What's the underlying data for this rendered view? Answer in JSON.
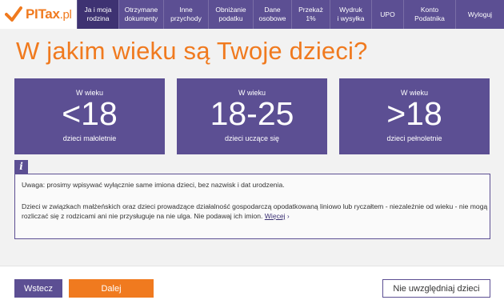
{
  "logo": {
    "text_main": "PITax",
    "text_suffix": ".pl"
  },
  "nav": {
    "items": [
      {
        "label": "Ja i moja\nrodzina",
        "active": true,
        "width": 52
      },
      {
        "label": "Otrzymane\ndokumenty",
        "active": false,
        "width": 56
      },
      {
        "label": "Inne\nprzychody",
        "active": false,
        "width": 56
      },
      {
        "label": "Obniżanie\npodatku",
        "active": false,
        "width": 56
      },
      {
        "label": "Dane\nosobowe",
        "active": false,
        "width": 48
      },
      {
        "label": "Przekaż\n1%",
        "active": false,
        "width": 48
      },
      {
        "label": "Wydruk\ni wysyłka",
        "active": false,
        "width": 52
      },
      {
        "label": "UPO",
        "active": false,
        "width": 40
      },
      {
        "label": "Konto\nPodatnika",
        "active": false,
        "width": 65
      },
      {
        "label": "Wyloguj",
        "active": false,
        "width": 61
      }
    ]
  },
  "page": {
    "title": "W jakim wieku są Twoje dzieci?"
  },
  "cards": [
    {
      "small": "W wieku",
      "big": "<18",
      "desc": "dzieci małoletnie"
    },
    {
      "small": "W wieku",
      "big": "18-25",
      "desc": "dzieci uczące się"
    },
    {
      "small": "W wieku",
      "big": ">18",
      "desc": "dzieci pełnoletnie"
    }
  ],
  "info": {
    "icon": "i",
    "line1": "Uwaga: prosimy wpisywać wyłącznie same imiona dzieci, bez nazwisk i dat urodzenia.",
    "line2": "Dzieci w związkach małżeńskich oraz dzieci prowadzące działalność gospodarczą opodatkowaną liniowo lub ryczałtem - niezależnie od wieku - nie mogą rozliczać się z rodzicami ani nie przysługuje na nie ulga. Nie podawaj ich imion.",
    "more": "Więcej",
    "more_arrow": "›"
  },
  "footer": {
    "back": "Wstecz",
    "next": "Dalej",
    "ignore": "Nie uwzględniaj dzieci"
  },
  "colors": {
    "brand_purple": "#5c4f93",
    "brand_purple_dark": "#3e3272",
    "brand_orange": "#f07a1f"
  }
}
